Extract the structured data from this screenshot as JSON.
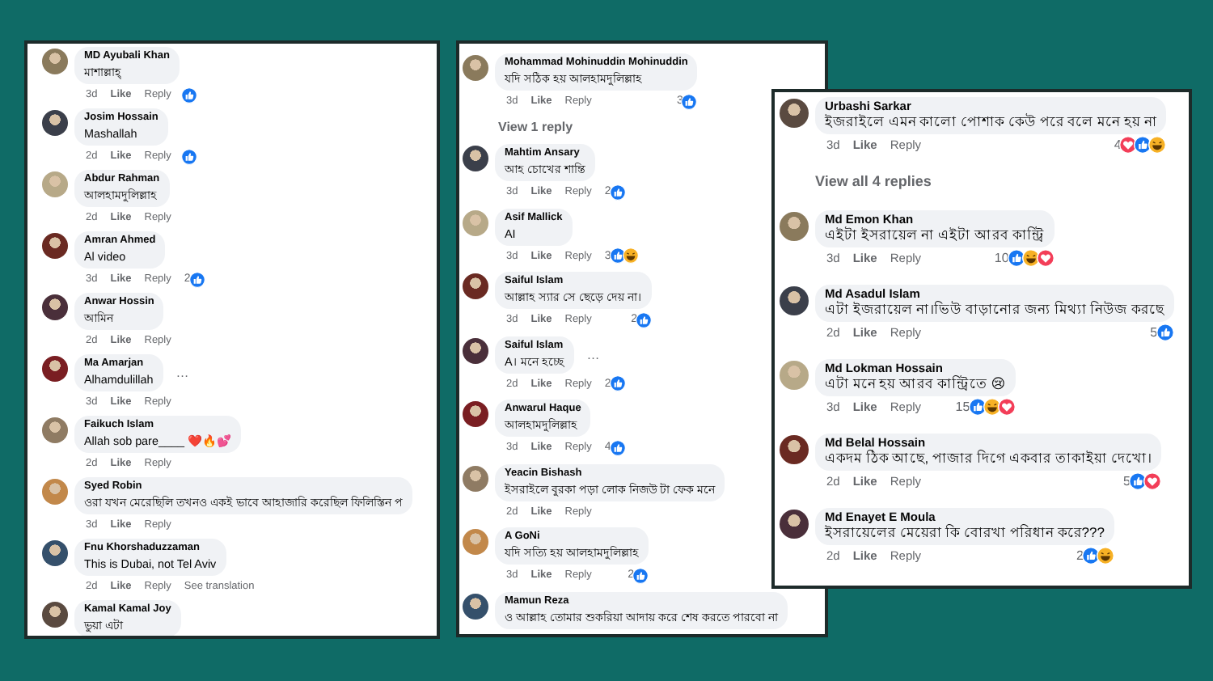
{
  "panels": [
    {
      "comments": [
        {
          "kind": "comment",
          "author": "MD Ayubali Khan",
          "text": "মাশাল্লাহ্",
          "time": "3d",
          "actions": [
            "Like",
            "Reply"
          ],
          "reactions": [
            {
              "kind": "like"
            }
          ]
        },
        {
          "kind": "comment",
          "author": "Josim Hossain",
          "text": "Mashallah",
          "time": "2d",
          "actions": [
            "Like",
            "Reply"
          ],
          "reactions": [
            {
              "kind": "like"
            }
          ]
        },
        {
          "kind": "comment",
          "author": "Abdur Rahman",
          "text": "আলহামদুলিল্লাহ",
          "time": "2d",
          "actions": [
            "Like",
            "Reply"
          ]
        },
        {
          "kind": "comment",
          "author": "Amran Ahmed",
          "text": "Al video",
          "time": "3d",
          "actions": [
            "Like",
            "Reply"
          ],
          "reaction_count": "2",
          "reactions": [
            {
              "kind": "like"
            }
          ]
        },
        {
          "kind": "comment",
          "author": "Anwar Hossin",
          "text": "আমিন",
          "time": "2d",
          "actions": [
            "Like",
            "Reply"
          ]
        },
        {
          "kind": "comment",
          "author": "Ma Amarjan",
          "text": "Alhamdulillah",
          "more": "…",
          "time": "3d",
          "actions": [
            "Like",
            "Reply"
          ]
        },
        {
          "kind": "comment",
          "author": "Faikuch Islam",
          "text": "Allah sob pare____ ❤️🔥💕",
          "time": "2d",
          "actions": [
            "Like",
            "Reply"
          ]
        },
        {
          "kind": "comment",
          "author": "Syed Robin",
          "text": "ওরা যখন মেরেছিলি তখনও একই ভাবে আহাজারি করেছিল ফিলিস্তিন প",
          "time": "3d",
          "actions": [
            "Like",
            "Reply"
          ]
        },
        {
          "kind": "comment",
          "author": "Fnu Khorshaduzzaman",
          "text": "This is Dubai, not Tel Aviv",
          "time": "2d",
          "actions": [
            "Like",
            "Reply"
          ],
          "extra": "See translation"
        },
        {
          "kind": "comment",
          "author": "Kamal Kamal Joy",
          "text": "ভুয়া এটা"
        }
      ]
    },
    {
      "comments": [
        {
          "kind": "comment",
          "author": "Mohammad Mohinuddin Mohinuddin",
          "text": "যদি সঠিক হয় আলহামদুলিল্লাহ",
          "time": "3d",
          "actions": [
            "Like",
            "Reply"
          ],
          "reaction_count": "3",
          "reactions": [
            {
              "kind": "like"
            }
          ]
        },
        {
          "kind": "replies-link",
          "label": "View 1 reply"
        },
        {
          "kind": "comment",
          "author": "Mahtim Ansary",
          "text": "আহ চোখের শান্তি",
          "time": "3d",
          "actions": [
            "Like",
            "Reply"
          ],
          "reaction_count": "2",
          "reactions": [
            {
              "kind": "like"
            }
          ]
        },
        {
          "kind": "comment",
          "author": "Asif Mallick",
          "text": "AI",
          "time": "3d",
          "actions": [
            "Like",
            "Reply"
          ],
          "reaction_count": "3",
          "reactions": [
            {
              "kind": "like"
            },
            {
              "kind": "haha"
            }
          ]
        },
        {
          "kind": "comment",
          "author": "Saiful Islam",
          "text": "আল্লাহ স্যার সে ছেড়ে দেয় না।",
          "time": "3d",
          "actions": [
            "Like",
            "Reply"
          ],
          "reaction_count": "2",
          "reactions": [
            {
              "kind": "like"
            }
          ]
        },
        {
          "kind": "comment",
          "author": "Saiful Islam",
          "text": "A। মনে হচ্ছে",
          "more": "…",
          "time": "2d",
          "actions": [
            "Like",
            "Reply"
          ],
          "reaction_count": "2",
          "reactions": [
            {
              "kind": "like"
            }
          ]
        },
        {
          "kind": "comment",
          "author": "Anwarul Haque",
          "text": "আলহামদুলিল্লাহ",
          "time": "3d",
          "actions": [
            "Like",
            "Reply"
          ],
          "reaction_count": "4",
          "reactions": [
            {
              "kind": "like"
            }
          ]
        },
        {
          "kind": "comment",
          "author": "Yeacin Bishash",
          "text": "ইসরাইলে বুরকা পড়া লোক নিজউ টা ফেক মনে",
          "time": "2d",
          "actions": [
            "Like",
            "Reply"
          ]
        },
        {
          "kind": "comment",
          "author": "A GoNi",
          "text": "যদি সত্যি হয় আলহামদুলিল্লাহ",
          "time": "3d",
          "actions": [
            "Like",
            "Reply"
          ],
          "reaction_count": "2",
          "reactions": [
            {
              "kind": "like"
            }
          ]
        },
        {
          "kind": "comment",
          "author": "Mamun Reza",
          "text": "ও আল্লাহ তোমার শুকরিয়া আদায় করে শেষ করতে পারবো না"
        }
      ]
    },
    {
      "comments": [
        {
          "kind": "comment",
          "author": "Urbashi Sarkar",
          "text": "ইজরাইলে এমন কালো পোশাক কেউ পরে বলে মনে হয় না",
          "time": "3d",
          "actions": [
            "Like",
            "Reply"
          ],
          "reaction_count": "4",
          "reactions": [
            {
              "kind": "love"
            },
            {
              "kind": "like"
            },
            {
              "kind": "haha"
            }
          ]
        },
        {
          "kind": "replies-link",
          "label": "View all 4 replies"
        },
        {
          "kind": "comment",
          "author": "Md Emon Khan",
          "text": "এইটা ইসরায়েল না এইটা আরব কান্ট্রি",
          "time": "3d",
          "actions": [
            "Like",
            "Reply"
          ],
          "reaction_count": "10",
          "reactions": [
            {
              "kind": "like"
            },
            {
              "kind": "haha"
            },
            {
              "kind": "love"
            }
          ]
        },
        {
          "kind": "comment",
          "author": "Md Asadul Islam",
          "text": "এটা ইজরায়েল না।ভিউ বাড়ানোর জন্য মিথ্যা নিউজ করছে",
          "time": "2d",
          "actions": [
            "Like",
            "Reply"
          ],
          "reaction_count": "5",
          "reactions": [
            {
              "kind": "like"
            }
          ]
        },
        {
          "kind": "comment",
          "author": "Md Lokman Hossain",
          "text": "এটা মনে হয় আরব কান্ট্রিতে 😢",
          "time": "3d",
          "actions": [
            "Like",
            "Reply"
          ],
          "reaction_count": "15",
          "reactions": [
            {
              "kind": "like"
            },
            {
              "kind": "haha"
            },
            {
              "kind": "love"
            }
          ]
        },
        {
          "kind": "comment",
          "author": "Md Belal Hossain",
          "text": "একদম ঠিক আছে, পাজার দিগে একবার তাকাইয়া দেখো।",
          "time": "2d",
          "actions": [
            "Like",
            "Reply"
          ],
          "reaction_count": "5",
          "reactions": [
            {
              "kind": "like"
            },
            {
              "kind": "love"
            }
          ]
        },
        {
          "kind": "comment",
          "author": "Md Enayet E Moula",
          "text": "ইসরায়েলের মেয়েরা কি বোরখা পরিধান করে???",
          "time": "2d",
          "actions": [
            "Like",
            "Reply"
          ],
          "reaction_count": "2",
          "reactions": [
            {
              "kind": "like"
            },
            {
              "kind": "haha"
            }
          ]
        }
      ]
    }
  ]
}
